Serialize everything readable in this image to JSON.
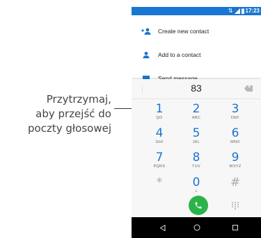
{
  "callout": {
    "line1": "Przytrzymaj,",
    "line2": "aby przejść do",
    "line3": "poczty głosowej"
  },
  "status_bar": {
    "time": "17:23",
    "icons": [
      "data-arrows-icon",
      "signal-icon",
      "battery-icon"
    ],
    "color": "#1976d2"
  },
  "menu": {
    "items": [
      {
        "label": "Create new contact",
        "icon": "add-person-icon"
      },
      {
        "label": "Add to a contact",
        "icon": "person-icon"
      },
      {
        "label": "Send message",
        "icon": "message-icon"
      }
    ]
  },
  "dialer": {
    "number": "83",
    "keys": [
      {
        "digit": "1",
        "letters": "QO"
      },
      {
        "digit": "2",
        "letters": "ABC"
      },
      {
        "digit": "3",
        "letters": "DEF"
      },
      {
        "digit": "4",
        "letters": "GHI"
      },
      {
        "digit": "5",
        "letters": "JKL"
      },
      {
        "digit": "6",
        "letters": "MNO"
      },
      {
        "digit": "7",
        "letters": "PQRS"
      },
      {
        "digit": "8",
        "letters": "TUV"
      },
      {
        "digit": "9",
        "letters": "WXYZ"
      },
      {
        "digit": "*",
        "letters": ""
      },
      {
        "digit": "0",
        "letters": "+"
      },
      {
        "digit": "#",
        "letters": ""
      }
    ],
    "accent": "#1976d2",
    "call_color": "#2bb34a"
  },
  "navbar": {
    "icons": [
      "back-icon",
      "home-icon",
      "recents-icon"
    ]
  }
}
